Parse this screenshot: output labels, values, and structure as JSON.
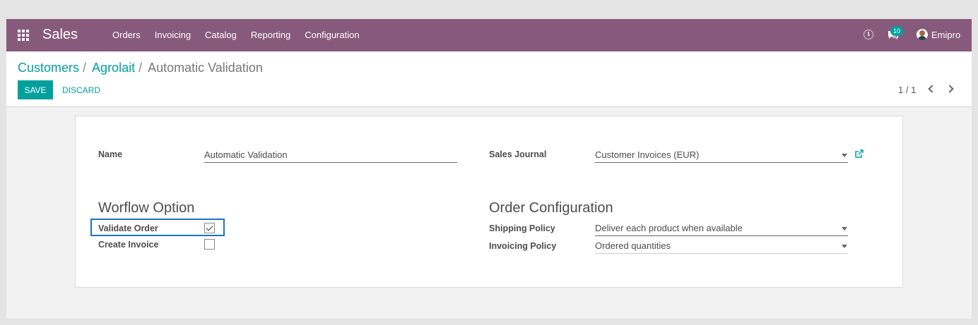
{
  "navbar": {
    "brand": "Sales",
    "menu": [
      "Orders",
      "Invoicing",
      "Catalog",
      "Reporting",
      "Configuration"
    ],
    "notification_count": "10",
    "username": "Emipro"
  },
  "breadcrumb": {
    "items": [
      "Customers",
      "Agrolait"
    ],
    "separator": "/",
    "current": "Automatic Validation"
  },
  "actions": {
    "save_label": "SAVE",
    "discard_label": "DISCARD"
  },
  "pager": {
    "value": "1 / 1"
  },
  "form": {
    "name_label": "Name",
    "name_value": "Automatic Validation",
    "sales_journal_label": "Sales Journal",
    "sales_journal_value": "Customer Invoices (EUR)",
    "workflow_title": "Worflow Option",
    "validate_order_label": "Validate Order",
    "validate_order_checked": true,
    "create_invoice_label": "Create Invoice",
    "create_invoice_checked": false,
    "order_config_title": "Order Configuration",
    "shipping_policy_label": "Shipping Policy",
    "shipping_policy_value": "Deliver each product when available",
    "invoicing_policy_label": "Invoicing Policy",
    "invoicing_policy_value": "Ordered quantities"
  },
  "colors": {
    "navbar": "#875a7b",
    "accent": "#00a09d",
    "highlight": "#1a73c8"
  }
}
